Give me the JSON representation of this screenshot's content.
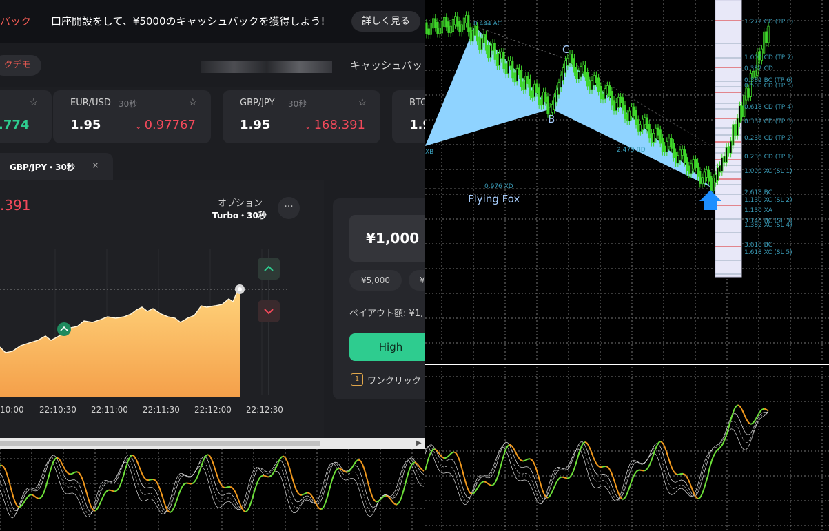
{
  "banner": {
    "promo_left": "バック",
    "promo_text": "口座開設をして、¥5000のキャッシュバックを獲得しよう!",
    "more_button": "詳しく見る"
  },
  "subbar": {
    "demo_badge": "クデモ",
    "cashback": "キャッシュバッ"
  },
  "cards": [
    {
      "pair": "",
      "tf": "",
      "payout": ".774",
      "price": "",
      "price_color": "#2ecc8f"
    },
    {
      "pair": "EUR/USD",
      "tf": "30秒",
      "payout": "1.95",
      "price": "0.97767"
    },
    {
      "pair": "GBP/JPY",
      "tf": "30秒",
      "payout": "1.95",
      "price": "168.391"
    },
    {
      "pair": "BTC",
      "tf": "",
      "payout": "1.9",
      "price": ""
    }
  ],
  "tab": {
    "label": "GBP/JPY・30秒",
    "close": "×"
  },
  "chart": {
    "price": ".391",
    "option_label": "オプション",
    "option_value": "Turbo・30秒",
    "more": "···",
    "time_ticks": [
      "10:00",
      "22:10:30",
      "22:11:00",
      "22:11:30",
      "22:12:00",
      "22:12:30"
    ]
  },
  "trade": {
    "amount": "¥1,000",
    "chips": [
      "¥5,000",
      "¥"
    ],
    "payout_label": "ペイアウト額: ¥1,",
    "high_button": "High",
    "one_click": "ワンクリック",
    "one_click_icon": "1"
  },
  "mt4": {
    "pattern_name": "Flying Fox",
    "point_b": "B",
    "point_c": "C",
    "label_xd": "0.976 XD",
    "label_bd": "2.479 BD",
    "label_ac": "0.444 AC",
    "label_xb": "XB",
    "levels": [
      {
        "text": "1.272 CD (TP 8)",
        "color": "#3a9cb8"
      },
      {
        "text": "1.000 CD (TP 7)",
        "color": "#3a9cb8"
      },
      {
        "text": "0.382 CD",
        "color": "#3a9cb8"
      },
      {
        "text": "0.382 BC (TP 6)",
        "color": "#3a9cb8"
      },
      {
        "text": "0.500 CD (TP 5)",
        "color": "#3a9cb8"
      },
      {
        "text": "0.618 CD (TP 4)",
        "color": "#3a9cb8"
      },
      {
        "text": "0.382 CD (TP 3)",
        "color": "#3a9cb8"
      },
      {
        "text": "0.236 CD (TP 2)",
        "color": "#3a9cb8"
      },
      {
        "text": "0.236 CD (TP 1)",
        "color": "#3a9cb8"
      },
      {
        "text": "1.000 XC (SL 1)",
        "color": "#3a9cb8"
      },
      {
        "text": "2.618 BC",
        "color": "#3a9cb8"
      },
      {
        "text": "1.130 XC (SL 2)",
        "color": "#3a9cb8"
      },
      {
        "text": "1.130 XA",
        "color": "#3a9cb8"
      },
      {
        "text": "3.146 BC (SL 3)",
        "color": "#3a9cb8"
      },
      {
        "text": "1.382 XC (SL 4)",
        "color": "#3a9cb8"
      },
      {
        "text": "3.618 BC",
        "color": "#3a9cb8"
      },
      {
        "text": "1.618 XC (SL 5)",
        "color": "#3a9cb8"
      }
    ]
  },
  "colors": {
    "bg_left": "#1d1e22",
    "red": "#f2495a",
    "green": "#2ecc8f",
    "area_fill_top": "#ffd27a",
    "area_fill_bottom": "#f4a04a",
    "candle_green": "#3fd62a",
    "pattern_fill": "#8fd3ff",
    "arrow_blue": "#1e8fff"
  },
  "icons": {
    "star": "star-icon",
    "close": "close-icon",
    "up": "chevron-up-icon",
    "down": "chevron-down-icon",
    "arrow_up": "arrow-up-icon"
  }
}
